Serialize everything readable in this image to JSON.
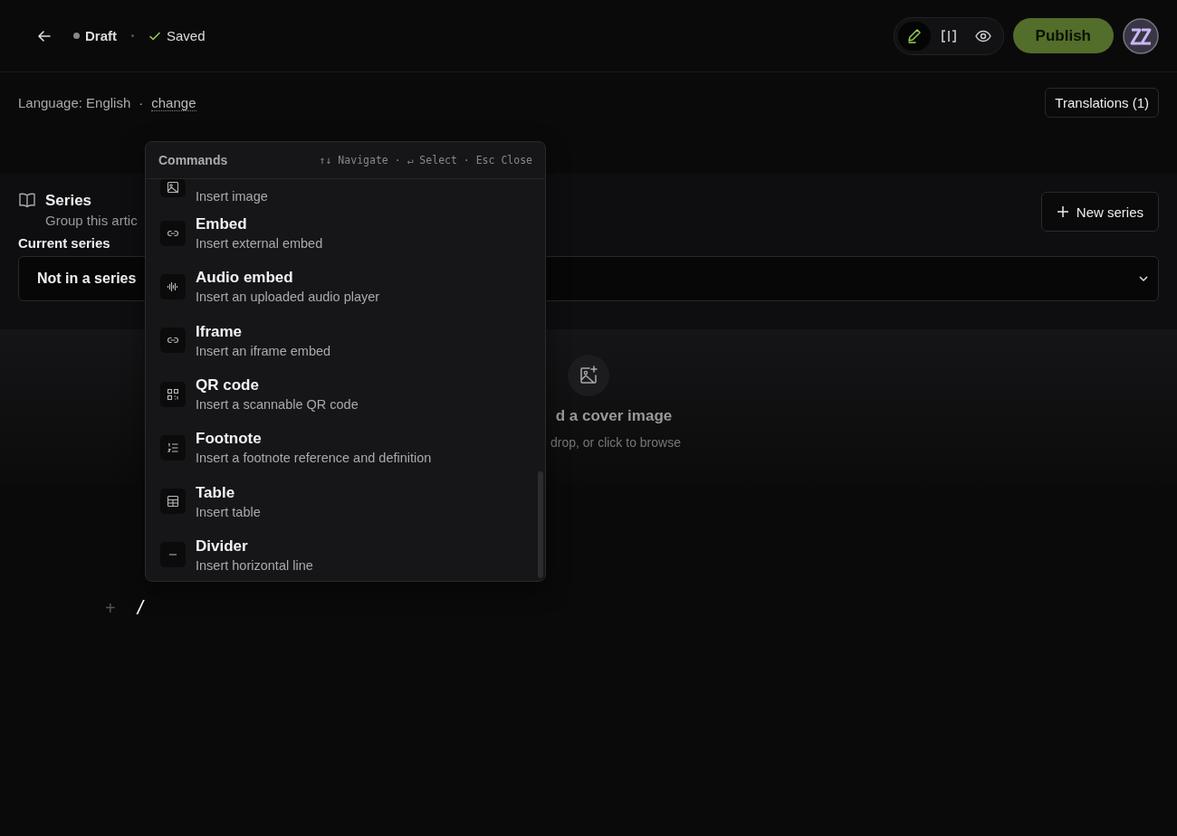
{
  "topbar": {
    "status": "Draft",
    "save_state": "Saved",
    "view_modes": [
      {
        "kind": "edit",
        "selected": true
      },
      {
        "kind": "split",
        "selected": false
      },
      {
        "kind": "preview",
        "selected": false
      }
    ],
    "publish": "Publish"
  },
  "language": {
    "label": "Language: English",
    "separator": "·",
    "change": "change",
    "translations": "Translations (1)"
  },
  "series": {
    "title": "Series",
    "description": "Group this artic",
    "new_button": "New series",
    "current_label": "Current series",
    "current_value": "Not in a series"
  },
  "cover": {
    "title": "d a cover image",
    "hint": "drop, or click to browse"
  },
  "editor": {
    "add": "+",
    "line": "/"
  },
  "commands": {
    "title": "Commands",
    "hint": "↑↓ Navigate · ↵ Select · Esc Close",
    "items": [
      {
        "kind": "image",
        "description": "Insert image"
      },
      {
        "kind": "link",
        "title": "Embed",
        "description": "Insert external embed"
      },
      {
        "kind": "audio",
        "title": "Audio embed",
        "description": "Insert an uploaded audio player"
      },
      {
        "kind": "link",
        "title": "Iframe",
        "description": "Insert an iframe embed"
      },
      {
        "kind": "qr",
        "title": "QR code",
        "description": "Insert a scannable QR code"
      },
      {
        "kind": "list",
        "title": "Footnote",
        "description": "Insert a footnote reference and definition"
      },
      {
        "kind": "table",
        "title": "Table",
        "description": "Insert table"
      },
      {
        "kind": "divider",
        "title": "Divider",
        "description": "Insert horizontal line"
      }
    ]
  }
}
